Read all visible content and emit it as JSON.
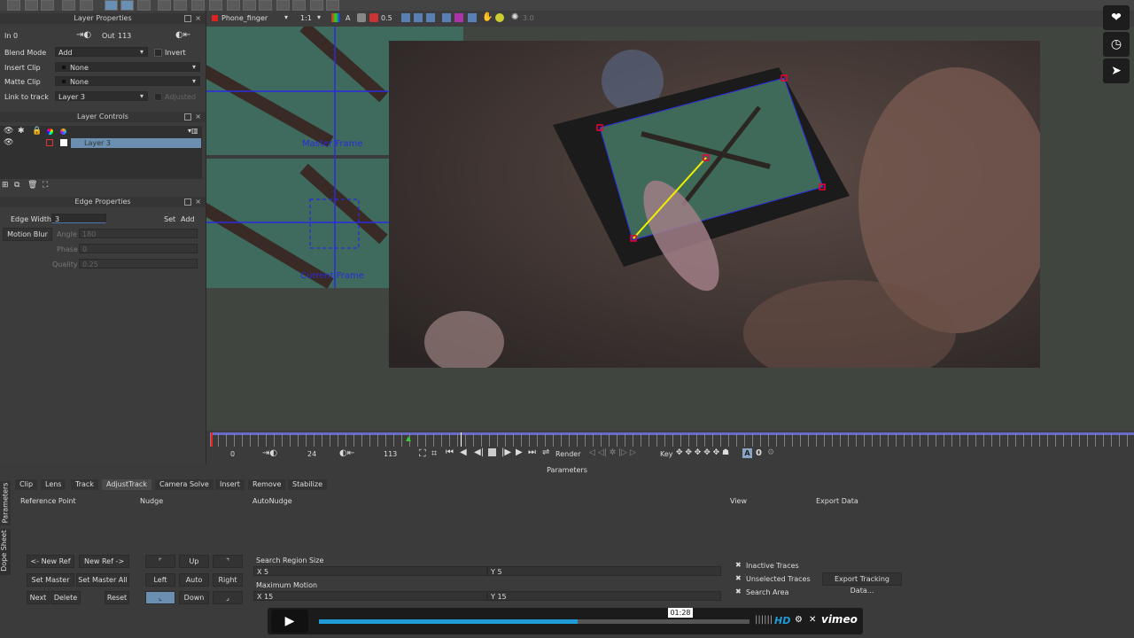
{
  "left_panel": {
    "layer_properties": {
      "title": "Layer Properties",
      "in_label": "In",
      "in_value": "0",
      "out_label": "Out",
      "out_value": "113",
      "blend_mode_label": "Blend Mode",
      "blend_mode_value": "Add",
      "invert_label": "Invert",
      "insert_clip_label": "Insert Clip",
      "insert_clip_value": "None",
      "matte_clip_label": "Matte Clip",
      "matte_clip_value": "None",
      "link_to_track_label": "Link to track",
      "link_to_track_value": "Layer 3",
      "adjusted_label": "Adjusted"
    },
    "layer_controls": {
      "title": "Layer Controls",
      "layer_name": "Layer 3"
    },
    "edge_properties": {
      "title": "Edge Properties",
      "edge_width_label": "Edge Width",
      "edge_width_value": "3",
      "set_label": "Set",
      "add_label": "Add",
      "motion_blur_label": "Motion Blur",
      "angle_label": "Angle",
      "angle_value": "180",
      "phase_label": "Phase",
      "phase_value": "0",
      "quality_label": "Quality",
      "quality_value": "0.25"
    }
  },
  "viewer": {
    "clip_name": "Phone_finger",
    "zoom": "1:1",
    "a_label": "A",
    "opacity": "0.5",
    "num_label": "3.0",
    "master_frame_label": "Master Frame",
    "current_frame_label": "Current Frame"
  },
  "timeline": {
    "start": "0",
    "current": "24",
    "end": "113",
    "render_label": "Render",
    "key_label": "Key",
    "zero_label": "0"
  },
  "params": {
    "title": "Parameters",
    "side_tabs": [
      "Parameters",
      "Dope Sheet"
    ],
    "tabs": [
      "Clip",
      "Lens",
      "Track",
      "AdjustTrack",
      "Camera Solve",
      "Insert",
      "Remove",
      "Stabilize"
    ],
    "active_tab": "AdjustTrack",
    "sections": {
      "reference_point": "Reference Point",
      "nudge": "Nudge",
      "autonudge": "AutoNudge",
      "view": "View",
      "export_data": "Export Data"
    },
    "reference_buttons": {
      "new_ref_prev": "<- New Ref",
      "new_ref_next": "New Ref ->",
      "set_master": "Set Master",
      "set_master_all": "Set Master All",
      "next": "Next",
      "delete": "Delete",
      "reset": "Reset"
    },
    "nudge_buttons": {
      "up": "Up",
      "left": "Left",
      "auto": "Auto",
      "right": "Right",
      "down": "Down"
    },
    "autonudge": {
      "search_region_size": "Search Region Size",
      "x_label": "X",
      "x_value": "5",
      "y_label": "Y",
      "y_value": "5",
      "maximum_motion": "Maximum Motion",
      "mm_x_value": "15",
      "mm_y_value": "15"
    },
    "view_options": [
      "Inactive Traces",
      "Unselected Traces",
      "Search Area"
    ],
    "export_button": "Export Tracking Data..."
  },
  "video_player": {
    "time": "01:28",
    "progress": 0.6,
    "hd_label": "HD",
    "brand": "vimeo"
  },
  "colors": {
    "accent_blue": "#1f9bd7",
    "track_blue": "#2a2ae0",
    "selected_layer": "#6b8fb0"
  }
}
